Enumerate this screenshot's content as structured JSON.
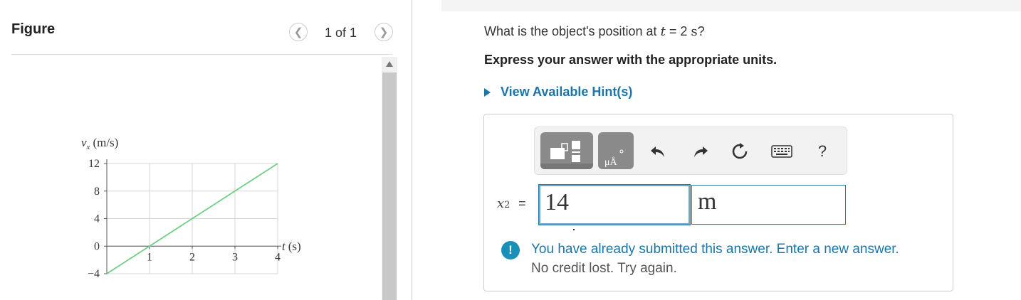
{
  "figure": {
    "title": "Figure",
    "pagination": "1 of 1",
    "prev_icon": "chevron-left",
    "next_icon": "chevron-right",
    "ylabel": "v",
    "ylabel_sub": "x",
    "ylabel_unit": "(m/s)",
    "xlabel": "t",
    "xlabel_unit": "(s)",
    "ytick_labels": [
      "12",
      "8",
      "4",
      "0",
      "−4"
    ],
    "xtick_labels": [
      "1",
      "2",
      "3",
      "4"
    ],
    "line_color": "#6fcf84"
  },
  "chart_data": {
    "type": "line",
    "title": "",
    "xlabel": "t (s)",
    "ylabel": "vx (m/s)",
    "x": [
      0,
      4
    ],
    "series": [
      {
        "values": [
          -4,
          12
        ]
      }
    ],
    "xlim": [
      0,
      4
    ],
    "ylim": [
      -4,
      12
    ],
    "xticks": [
      1,
      2,
      3,
      4
    ],
    "yticks": [
      -4,
      0,
      4,
      8,
      12
    ],
    "grid": true
  },
  "question": {
    "prefix": "What is the object's position at",
    "var": "t",
    "equals": "= 2",
    "unit": "s",
    "suffix": "?",
    "instruction": "Express your answer with the appropriate units.",
    "hint": "View Available Hint(s)"
  },
  "toolbar": {
    "units_symbol": "μÅ",
    "help": "?"
  },
  "answer": {
    "var": "x",
    "sub": "2",
    "equals": "=",
    "value": "14",
    "unit": "m"
  },
  "feedback": {
    "line1": "You have already submitted this answer. Enter a new answer.",
    "line2": "No credit lost. Try again.",
    "icon": "!"
  },
  "colors": {
    "accent": "#1c75a8",
    "info_icon": "#1a8fb8",
    "toolbar_button": "#8a8a8a"
  }
}
